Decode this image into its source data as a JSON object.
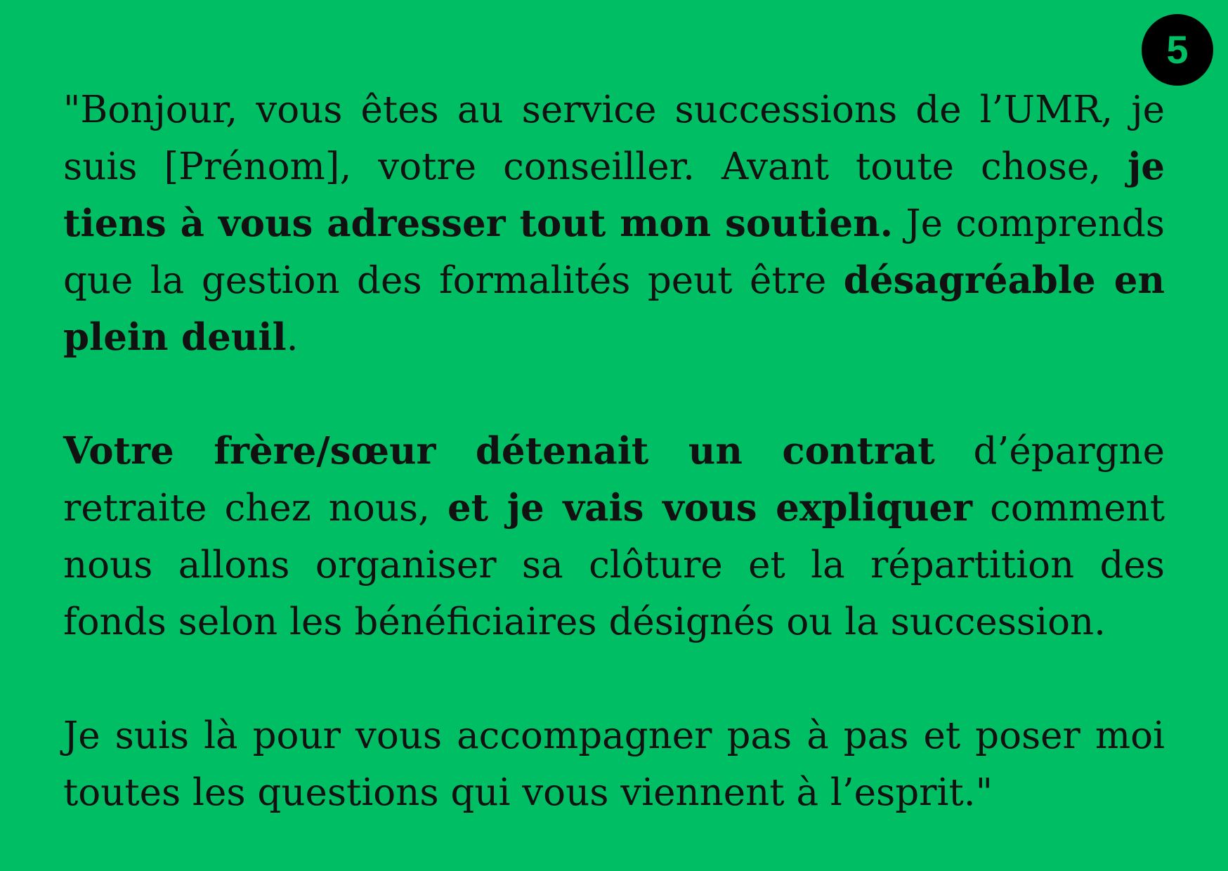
{
  "page_number": "5",
  "colors": {
    "background": "#00be64",
    "text": "#111111",
    "badge_background": "#000000"
  },
  "paragraphs": [
    {
      "segments": [
        {
          "text": "\"Bonjour, vous êtes au service successions de l’UMR, je suis [Prénom], votre conseiller. Avant toute chose, ",
          "bold": false
        },
        {
          "text": "je tiens à vous adresser tout mon soutien.",
          "bold": true
        },
        {
          "text": " Je comprends que la gestion des formalités peut être ",
          "bold": false
        },
        {
          "text": "désagréable en plein deuil",
          "bold": true
        },
        {
          "text": ".",
          "bold": false
        }
      ]
    },
    {
      "segments": [
        {
          "text": "Votre frère/sœur détenait un contrat",
          "bold": true
        },
        {
          "text": " d’épargne retraite chez nous, ",
          "bold": false
        },
        {
          "text": "et je vais vous expliquer",
          "bold": true
        },
        {
          "text": " comment nous allons organiser sa clôture et la répartition des fonds selon les bénéficiaires désignés ou la succession.",
          "bold": false
        }
      ]
    },
    {
      "segments": [
        {
          "text": "Je suis là pour vous accompagner pas à pas et poser moi toutes les questions qui vous viennent à l’esprit.\"",
          "bold": false
        }
      ]
    }
  ]
}
